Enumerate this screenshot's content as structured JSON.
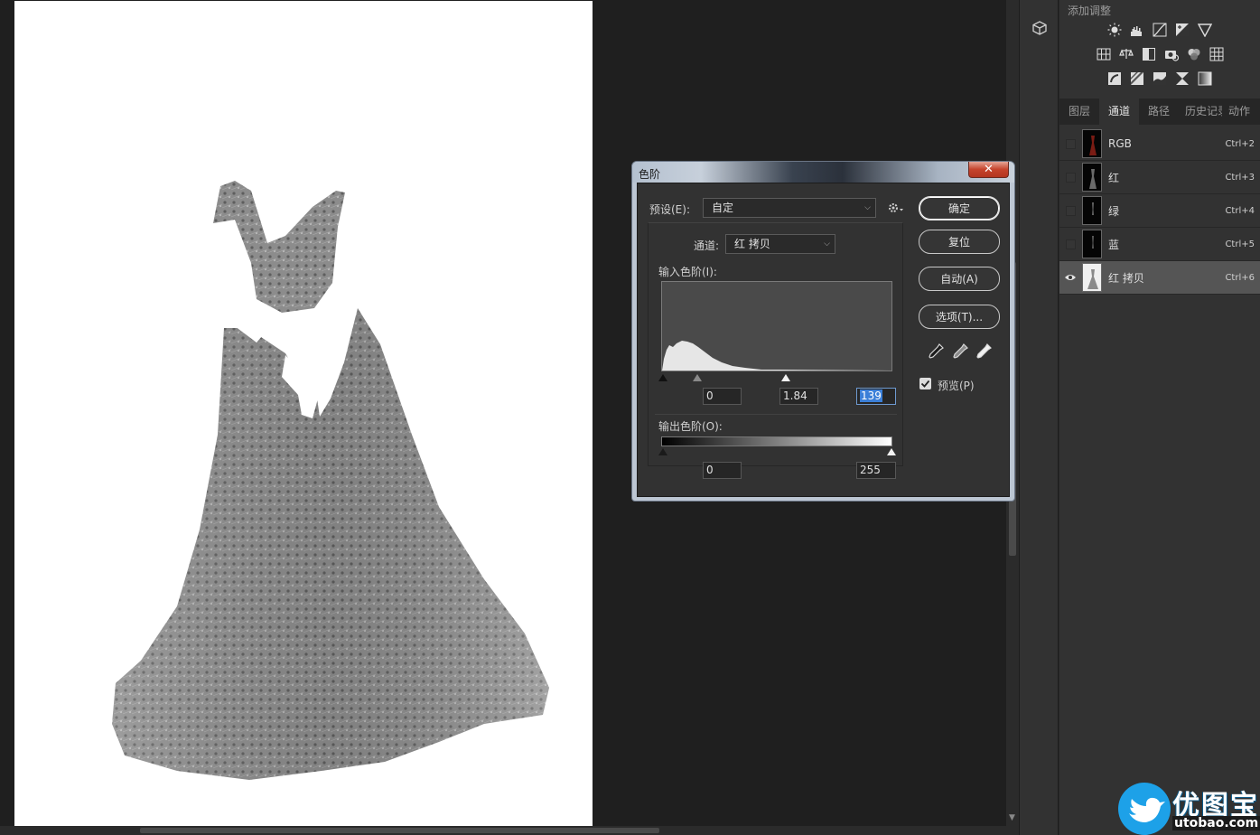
{
  "adjustments": {
    "title": "添加调整",
    "icons_row1": [
      "brightness-contrast-icon",
      "levels-icon",
      "curves-icon",
      "exposure-icon",
      "vibrance-icon"
    ],
    "icons_row2": [
      "hue-saturation-icon",
      "color-balance-icon",
      "black-white-icon",
      "photo-filter-icon",
      "channel-mixer-icon",
      "color-lookup-icon"
    ],
    "icons_row3": [
      "invert-icon",
      "posterize-icon",
      "threshold-icon",
      "selective-color-icon",
      "gradient-map-icon"
    ]
  },
  "panel_tabs": [
    "图层",
    "通道",
    "路径",
    "历史记录",
    "动作"
  ],
  "active_tab": "通道",
  "channels": [
    {
      "name": "RGB",
      "shortcut": "Ctrl+2",
      "visible": false
    },
    {
      "name": "红",
      "shortcut": "Ctrl+3",
      "visible": false
    },
    {
      "name": "绿",
      "shortcut": "Ctrl+4",
      "visible": false
    },
    {
      "name": "蓝",
      "shortcut": "Ctrl+5",
      "visible": false
    },
    {
      "name": "红 拷贝",
      "shortcut": "Ctrl+6",
      "visible": true
    }
  ],
  "dialog": {
    "title": "色阶",
    "preset_label": "预设(E):",
    "preset_value": "自定",
    "channel_label": "通道:",
    "channel_value": "红 拷贝",
    "input_label": "输入色阶(I):",
    "input_black": "0",
    "input_gamma": "1.84",
    "input_white": "139",
    "output_label": "输出色阶(O):",
    "output_black": "0",
    "output_white": "255",
    "buttons": {
      "ok": "确定",
      "reset": "复位",
      "auto": "自动(A)",
      "options": "选项(T)..."
    },
    "preview_label": "预览(P)",
    "preview_checked": true
  },
  "watermark": {
    "title": "优图宝",
    "url": "utobao.com"
  },
  "colors": {
    "workspace": "#1f1f1f",
    "panel": "#323232",
    "selected_row": "#555555",
    "accent": "#3b7fd8"
  }
}
